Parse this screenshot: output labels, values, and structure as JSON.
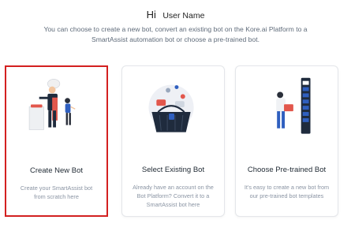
{
  "greeting": {
    "hi": "Hi",
    "user_name": "User Name"
  },
  "subtitle": "You can choose to create a new bot, convert an existing bot on the Kore.ai Platform to a SmartAssist automation bot or choose a pre-trained bot.",
  "cards": [
    {
      "title": "Create New Bot",
      "description": "Create your SmartAssist bot from scratch here",
      "selected": true,
      "icon": "chef-cooking-illustration"
    },
    {
      "title": "Select Existing Bot",
      "description": "Already have an account on the Bot Platform? Convert it to a SmartAssist bot here",
      "selected": false,
      "icon": "shopping-basket-illustration"
    },
    {
      "title": "Choose Pre-trained Bot",
      "description": "It's easy to create a new bot from our pre-trained bot templates",
      "selected": false,
      "icon": "server-rack-illustration"
    }
  ],
  "colors": {
    "selected_border": "#d32020",
    "accent_blue": "#2f5fbf",
    "accent_red": "#e2574c"
  }
}
